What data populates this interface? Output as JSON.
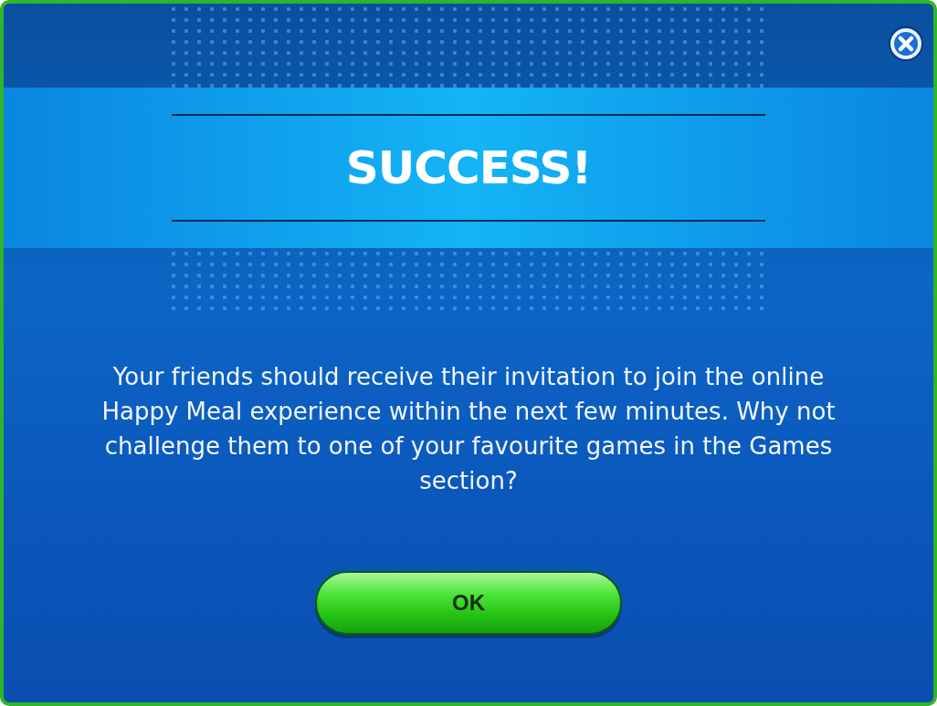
{
  "dialog": {
    "title": "SUCCESS!",
    "message": "Your friends should receive their invitation to join the online Happy Meal experience within the next few minutes. Why not challenge them to one of your favourite games in the Games section?",
    "buttons": [
      "OK"
    ]
  }
}
